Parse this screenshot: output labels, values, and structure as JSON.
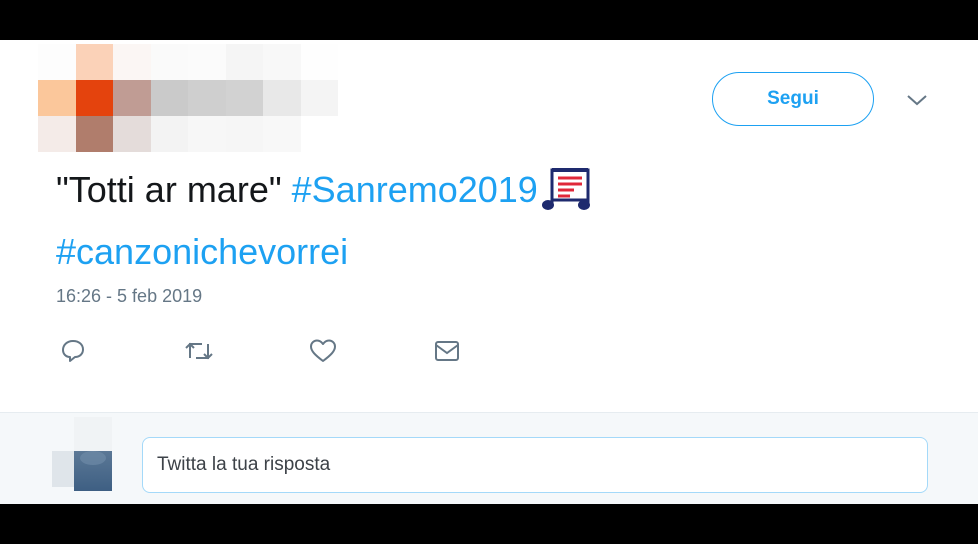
{
  "tweet": {
    "follow_label": "Segui",
    "text_plain": "\"Totti ar mare\"",
    "hashtags": [
      "#Sanremo2019",
      "#canzonichevorrei"
    ],
    "emoji": "musical-score",
    "timestamp": "16:26 - 5 feb 2019"
  },
  "actions": [
    {
      "icon": "reply-icon"
    },
    {
      "icon": "retweet-icon"
    },
    {
      "icon": "like-icon"
    },
    {
      "icon": "direct-message-icon"
    }
  ],
  "reply": {
    "placeholder": "Twitta la tua risposta"
  },
  "colors": {
    "accent": "#1da1f2",
    "text": "#14171a",
    "muted": "#657786",
    "reply_bg": "#f5f8fa"
  }
}
